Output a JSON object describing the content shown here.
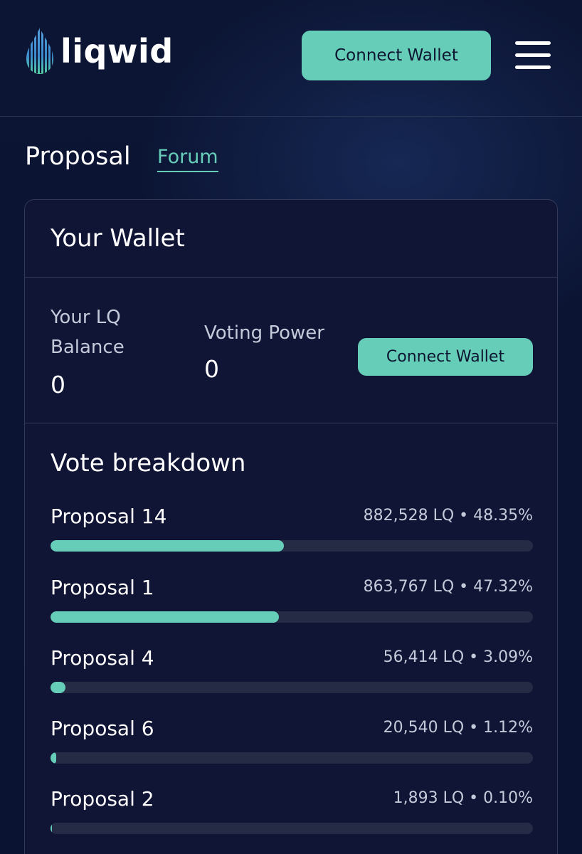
{
  "header": {
    "logo_text": "liqwid",
    "connect_label": "Connect Wallet",
    "menu_icon": "hamburger-menu-icon"
  },
  "tabs": {
    "proposal": "Proposal",
    "forum": "Forum"
  },
  "wallet": {
    "title": "Your Wallet",
    "lq_balance_label": "Your LQ Balance",
    "lq_balance_value": "0",
    "voting_power_label": "Voting Power",
    "voting_power_value": "0",
    "connect_label": "Connect Wallet"
  },
  "vote_breakdown": {
    "title": "Vote breakdown",
    "items": [
      {
        "name": "Proposal 14",
        "stats": "882,528 LQ • 48.35%",
        "percent": 48.35
      },
      {
        "name": "Proposal 1",
        "stats": "863,767 LQ • 47.32%",
        "percent": 47.32
      },
      {
        "name": "Proposal 4",
        "stats": "56,414 LQ • 3.09%",
        "percent": 3.09
      },
      {
        "name": "Proposal 6",
        "stats": "20,540 LQ • 1.12%",
        "percent": 1.12
      },
      {
        "name": "Proposal 2",
        "stats": "1,893 LQ • 0.10%",
        "percent": 0.1
      }
    ]
  },
  "colors": {
    "accent": "#66cdb9",
    "background": "#0b1433",
    "card": "#111535",
    "track": "#262b45"
  }
}
